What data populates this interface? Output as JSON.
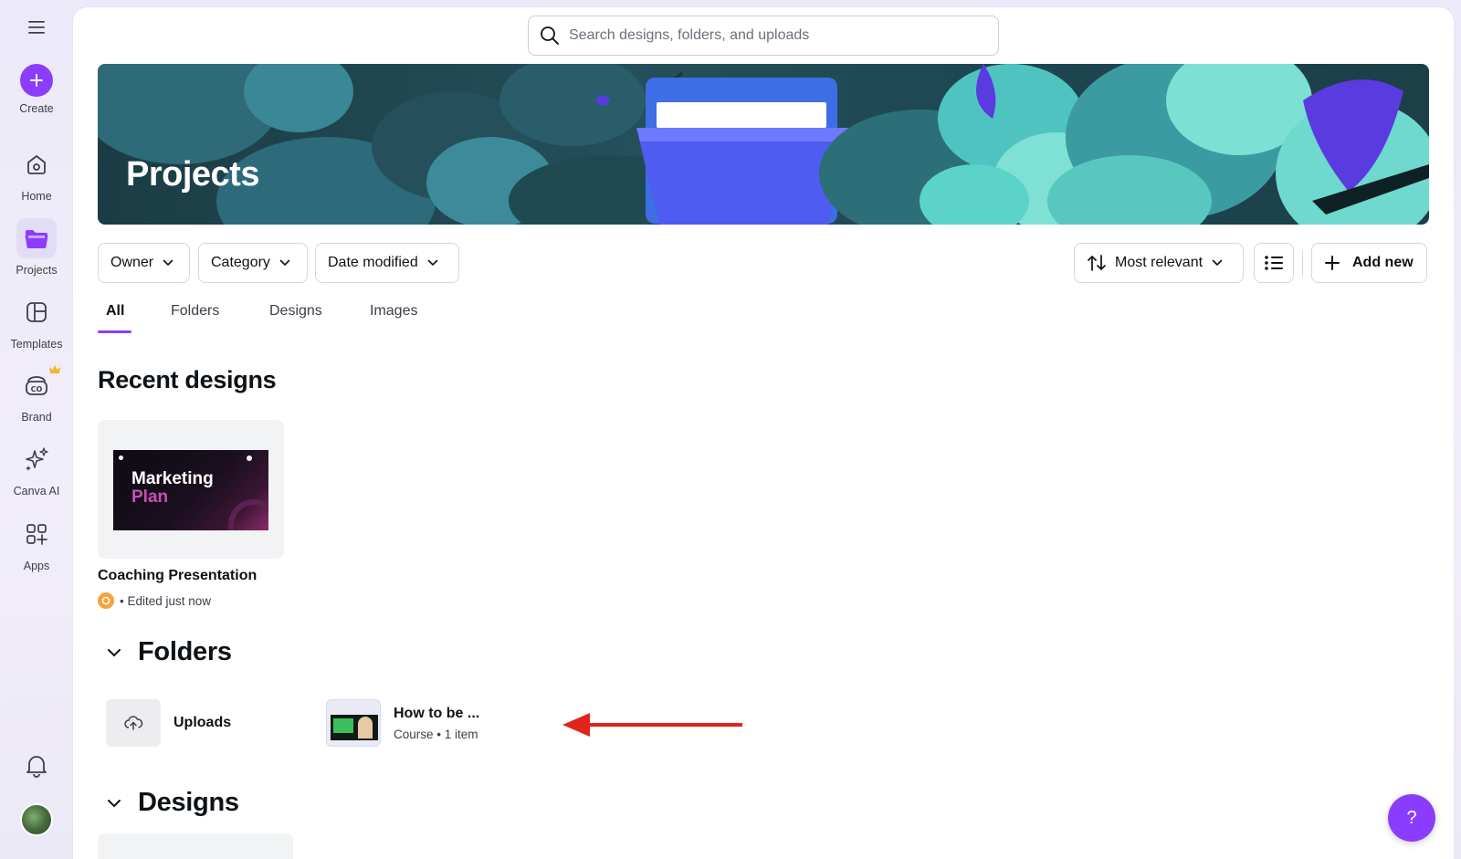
{
  "sidebar": {
    "menu_icon": "hamburger-icon",
    "items": [
      {
        "label": "Create",
        "icon": "plus-icon"
      },
      {
        "label": "Home",
        "icon": "home-icon"
      },
      {
        "label": "Projects",
        "icon": "folder-icon"
      },
      {
        "label": "Templates",
        "icon": "templates-icon"
      },
      {
        "label": "Brand",
        "icon": "brand-icon"
      },
      {
        "label": "Canva AI",
        "icon": "sparkles-icon"
      },
      {
        "label": "Apps",
        "icon": "apps-icon"
      }
    ],
    "active": "Projects",
    "bottom": {
      "notifications_icon": "bell-icon",
      "avatar": "avatar"
    }
  },
  "search": {
    "placeholder": "Search designs, folders, and uploads"
  },
  "banner": {
    "title": "Projects"
  },
  "filters": {
    "owner": "Owner",
    "category": "Category",
    "date_modified": "Date modified",
    "sort": "Most relevant",
    "add_new": "Add new"
  },
  "tabs": [
    "All",
    "Folders",
    "Designs",
    "Images"
  ],
  "active_tab": "All",
  "recent": {
    "heading": "Recent designs",
    "items": [
      {
        "title": "Coaching Presentation",
        "meta": "• Edited just now",
        "thumb_line1": "Marketing",
        "thumb_line2": "Plan"
      }
    ]
  },
  "folders": {
    "heading": "Folders",
    "items": [
      {
        "name": "Uploads",
        "sub": ""
      },
      {
        "name": "How to be ...",
        "sub": "Course • 1 item"
      }
    ]
  },
  "designs": {
    "heading": "Designs"
  },
  "help": {
    "label": "?"
  },
  "colors": {
    "accent": "#8b3dff",
    "annotation_arrow": "#e0261b"
  }
}
